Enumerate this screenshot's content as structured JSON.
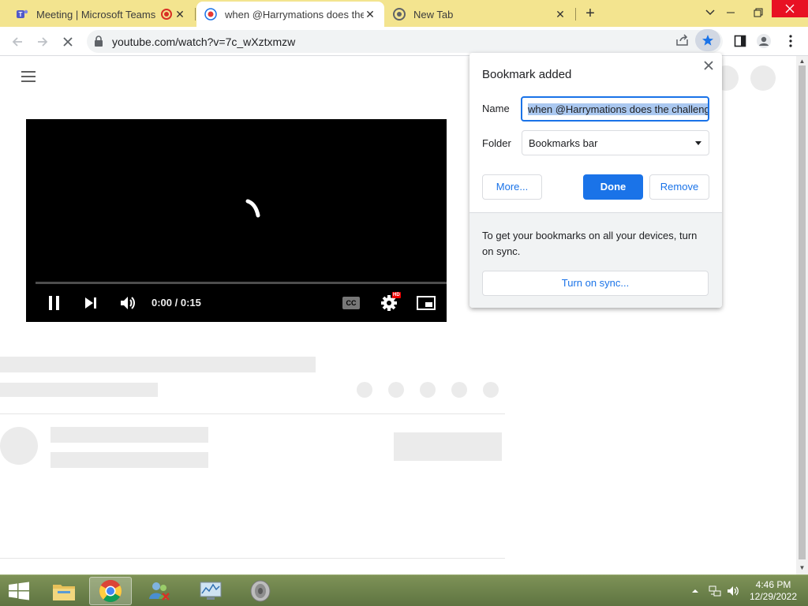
{
  "tabs": [
    {
      "title": "Meeting | Microsoft Teams",
      "favicon": "teams-icon",
      "recording": true
    },
    {
      "title": "when @Harrymations does the c",
      "favicon": "youtube-icon",
      "active": true
    },
    {
      "title": "New Tab",
      "favicon": "chrome-icon"
    }
  ],
  "address_bar": {
    "url": "youtube.com/watch?v=7c_wXztxmzw"
  },
  "video": {
    "timecode": "0:00 / 0:15",
    "hd_badge": "HD",
    "cc_label": "CC"
  },
  "bookmark_bubble": {
    "title": "Bookmark added",
    "name_label": "Name",
    "name_value": "when @Harrymations does the challenge",
    "folder_label": "Folder",
    "folder_value": "Bookmarks bar",
    "more_label": "More...",
    "done_label": "Done",
    "remove_label": "Remove",
    "sync_text": "To get your bookmarks on all your devices, turn on sync.",
    "sync_button": "Turn on sync..."
  },
  "taskbar": {
    "time": "4:46 PM",
    "date": "12/29/2022",
    "apps": [
      "file-explorer-icon",
      "chrome-icon",
      "people-icon",
      "task-manager-icon",
      "speaker-icon"
    ]
  },
  "colors": {
    "accent": "#1a73e8",
    "tabstrip": "#f3e48f",
    "close": "#e81123"
  }
}
